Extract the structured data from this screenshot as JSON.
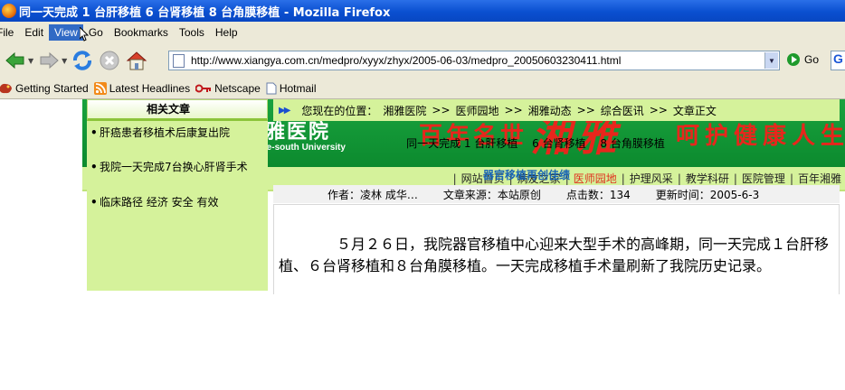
{
  "window": {
    "title": "同一天完成 1 台肝移植 6 台肾移植 8 台角膜移植 - Mozilla Firefox"
  },
  "menubar": {
    "items": [
      "File",
      "Edit",
      "View",
      "Go",
      "Bookmarks",
      "Tools",
      "Help"
    ],
    "active": "View"
  },
  "navbar": {
    "url": "http://www.xiangya.com.cn/medpro/xyyx/zhyx/2005-06-03/medpro_20050603230411.html",
    "go_label": "Go",
    "search_glyph": "G"
  },
  "bookmarks": [
    "Getting Started",
    "Latest Headlines",
    "Netscape",
    "Hotmail"
  ],
  "banner": {
    "hospital_cn": "中南大学湘雅医院",
    "hospital_en": "Xiangya Hospital of Centre-south University",
    "slogan_left": "百年名世",
    "slogan_big": "湘雅",
    "slogan_right": "呵护健康人生"
  },
  "topnav": {
    "items": [
      "网站首页",
      "病友之家",
      "医师园地",
      "护理风采",
      "教学科研",
      "医院管理",
      "百年湘雅"
    ],
    "current": "医师园地"
  },
  "sidebar": {
    "heading": "相关文章",
    "items": [
      "肝癌患者移植术后康复出院",
      "我院一天完成7台换心肝肾手术",
      "临床路径 经济 安全 有效"
    ]
  },
  "breadcrumb": {
    "label": "您现在的位置：",
    "items": [
      "湘雅医院",
      "医师园地",
      "湘雅动态",
      "综合医讯",
      "文章正文"
    ],
    "separator": ">>"
  },
  "article": {
    "title": "同一天完成 1 台肝移植　 6 台肾移植　 8 台角膜移植",
    "subtitle": "器官移植再创佳绩",
    "author": "作者：凌林 成华…",
    "source": "文章来源：本站原创",
    "hits": "点击数：134",
    "updated": "更新时间：2005-6-3",
    "body": "５月２６日，我院器官移植中心迎来大型手术的高峰期，同一天完成１台肝移植、６台肾移植和８台角膜移植。一天完成移植手术量刷新了我院历史记录。"
  },
  "colors": {
    "titlebar": "#0a4fd0",
    "chrome": "#ece9d8",
    "banner_green": "#0c8a2e",
    "light_green": "#d5f29b",
    "accent_red": "#e8261c",
    "link_blue": "#1a66b6"
  }
}
